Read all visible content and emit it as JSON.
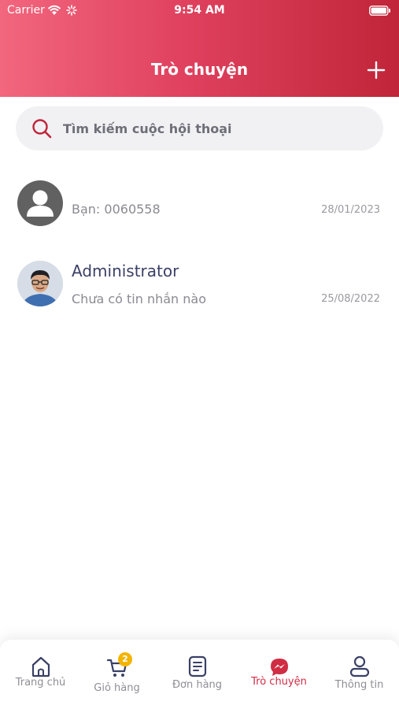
{
  "status_bar": {
    "carrier": "Carrier",
    "time": "9:54 AM"
  },
  "header": {
    "title": "Trò chuyện",
    "add_icon": "plus-icon"
  },
  "search": {
    "placeholder": "Tìm kiếm cuộc hội thoại",
    "value": ""
  },
  "conversations": [
    {
      "name": "",
      "last_message": "Bạn: 0060558",
      "date": "28/01/2023",
      "avatar": "default-user-avatar"
    },
    {
      "name": "Administrator",
      "last_message": "Chưa có tin nhắn nào",
      "date": "25/08/2022",
      "avatar": "user-photo"
    }
  ],
  "tabbar": {
    "items": [
      {
        "label": "Trang chủ",
        "icon": "home-icon"
      },
      {
        "label": "Giỏ hàng",
        "icon": "cart-icon",
        "badge": "2"
      },
      {
        "label": "Đơn hàng",
        "icon": "order-list-icon"
      },
      {
        "label": "Trò chuyện",
        "icon": "messenger-icon",
        "active": true
      },
      {
        "label": "Thông tin",
        "icon": "profile-icon"
      }
    ]
  },
  "colors": {
    "header_start": "#f2667e",
    "header_end": "#c02539",
    "accent": "#d02d45",
    "badge": "#f4b400"
  }
}
